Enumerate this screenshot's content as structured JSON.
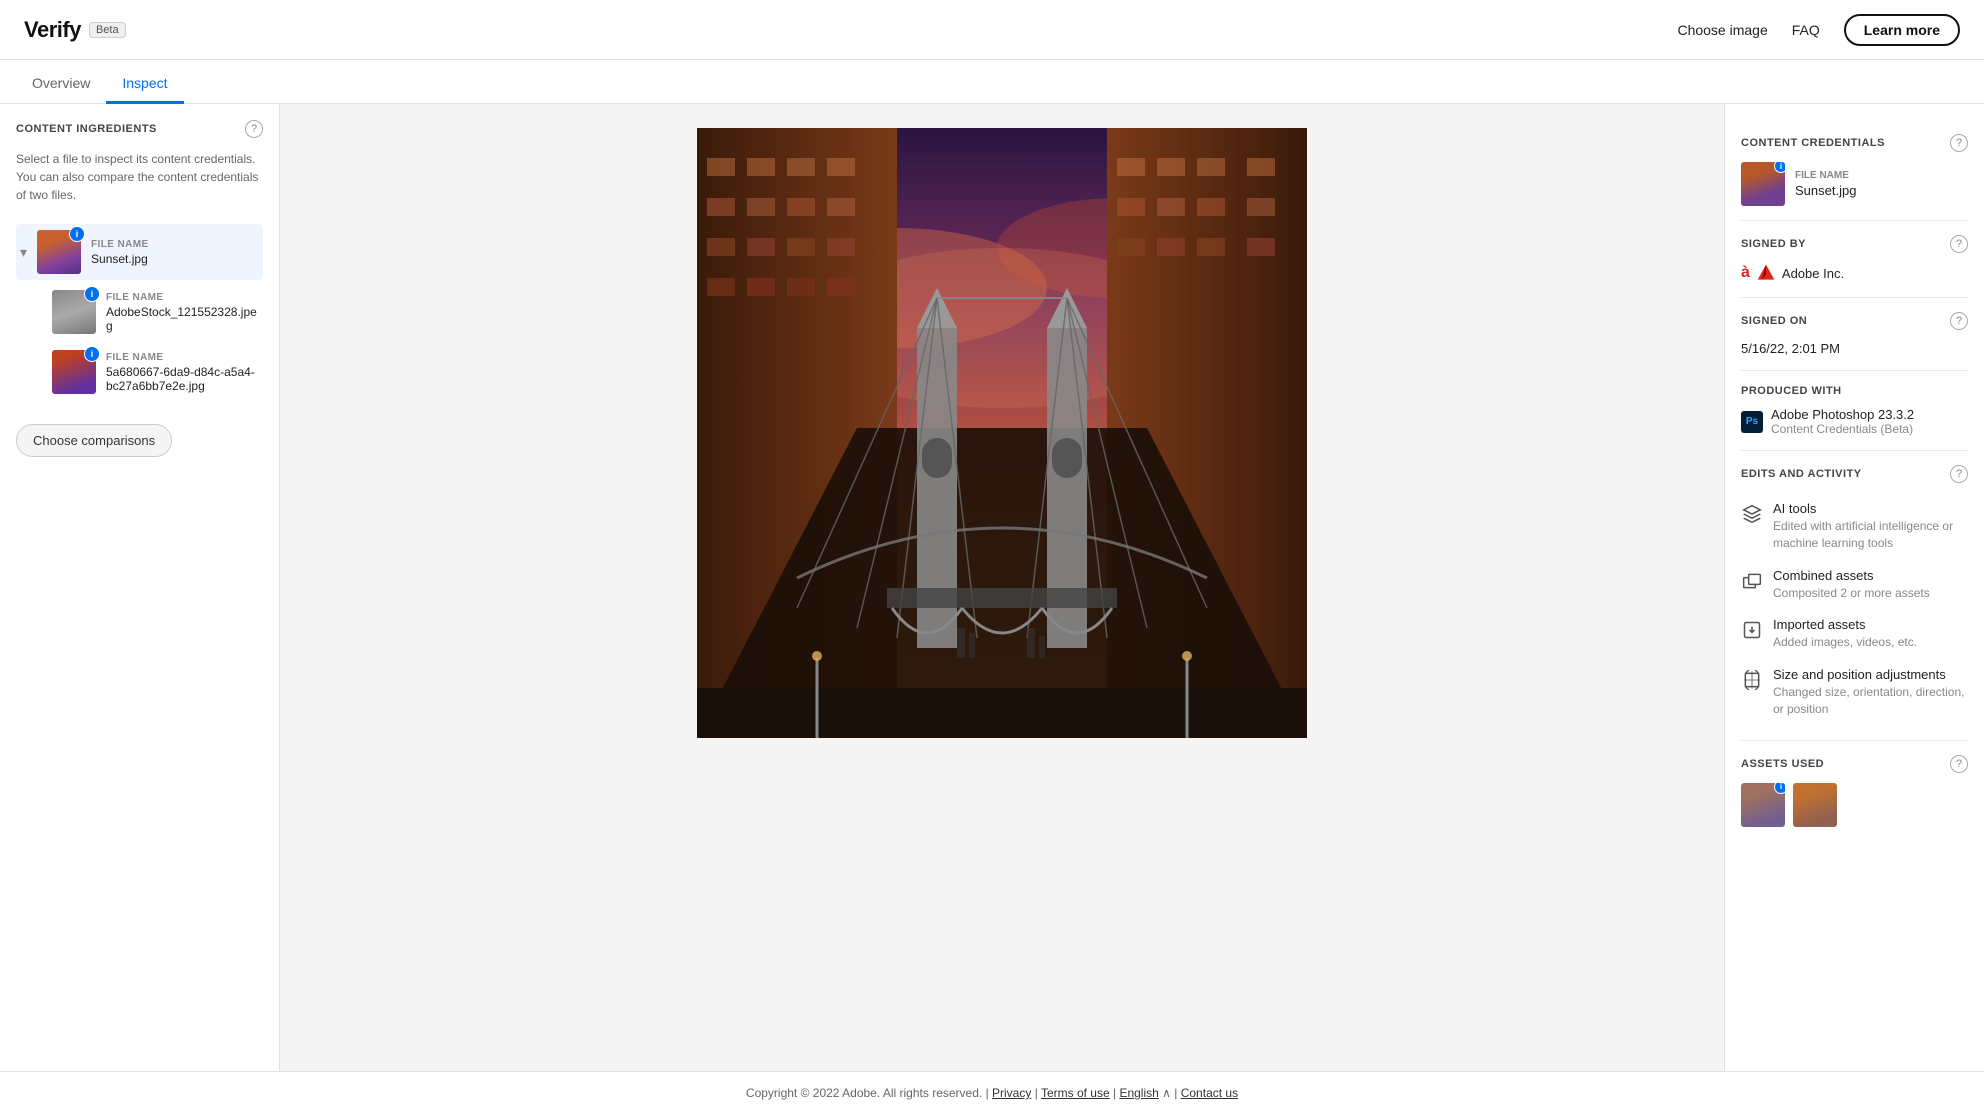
{
  "app": {
    "name": "Verify",
    "beta_label": "Beta"
  },
  "header": {
    "choose_image_label": "Choose image",
    "faq_label": "FAQ",
    "learn_more_label": "Learn more"
  },
  "tabs": [
    {
      "id": "overview",
      "label": "Overview",
      "active": false
    },
    {
      "id": "inspect",
      "label": "Inspect",
      "active": true
    }
  ],
  "left_panel": {
    "title": "CONTENT INGREDIENTS",
    "description": "Select a file to inspect its content credentials. You can also compare the content credentials of two files.",
    "files": [
      {
        "id": "sunset",
        "file_name_label": "FILE NAME",
        "file_name": "Sunset.jpg",
        "selected": true
      },
      {
        "id": "stock",
        "file_name_label": "FILE NAME",
        "file_name": "AdobeStock_121552328.jpeg",
        "selected": false
      },
      {
        "id": "uuid",
        "file_name_label": "FILE NAME",
        "file_name": "5a680667-6da9-d84c-a5a4-bc27a6bb7e2e.jpg",
        "selected": false
      }
    ],
    "choose_comparisons_label": "Choose comparisons"
  },
  "right_panel": {
    "content_credentials_title": "CONTENT CREDENTIALS",
    "file_name_label": "FILE NAME",
    "file_name": "Sunset.jpg",
    "signed_by_title": "SIGNED BY",
    "signed_by": "Adobe Inc.",
    "signed_on_title": "SIGNED ON",
    "signed_on": "5/16/22, 2:01 PM",
    "produced_with_title": "PRODUCED WITH",
    "produced_app_name": "Adobe Photoshop 23.3.2",
    "produced_app_sub": "Content Credentials (Beta)",
    "edits_activity_title": "EDITS AND ACTIVITY",
    "activities": [
      {
        "id": "ai-tools",
        "icon": "ai",
        "title": "AI tools",
        "description": "Edited with artificial intelligence or machine learning tools"
      },
      {
        "id": "combined-assets",
        "icon": "layers",
        "title": "Combined assets",
        "description": "Composited 2 or more assets"
      },
      {
        "id": "imported-assets",
        "icon": "import",
        "title": "Imported assets",
        "description": "Added images, videos, etc."
      },
      {
        "id": "size-position",
        "icon": "resize",
        "title": "Size and position adjustments",
        "description": "Changed size, orientation, direction, or position"
      }
    ],
    "assets_used_title": "ASSETS USED"
  },
  "footer": {
    "copyright": "Copyright © 2022 Adobe. All rights reserved.",
    "privacy_label": "Privacy",
    "terms_label": "Terms of use",
    "english_label": "English",
    "contact_label": "Contact us"
  }
}
